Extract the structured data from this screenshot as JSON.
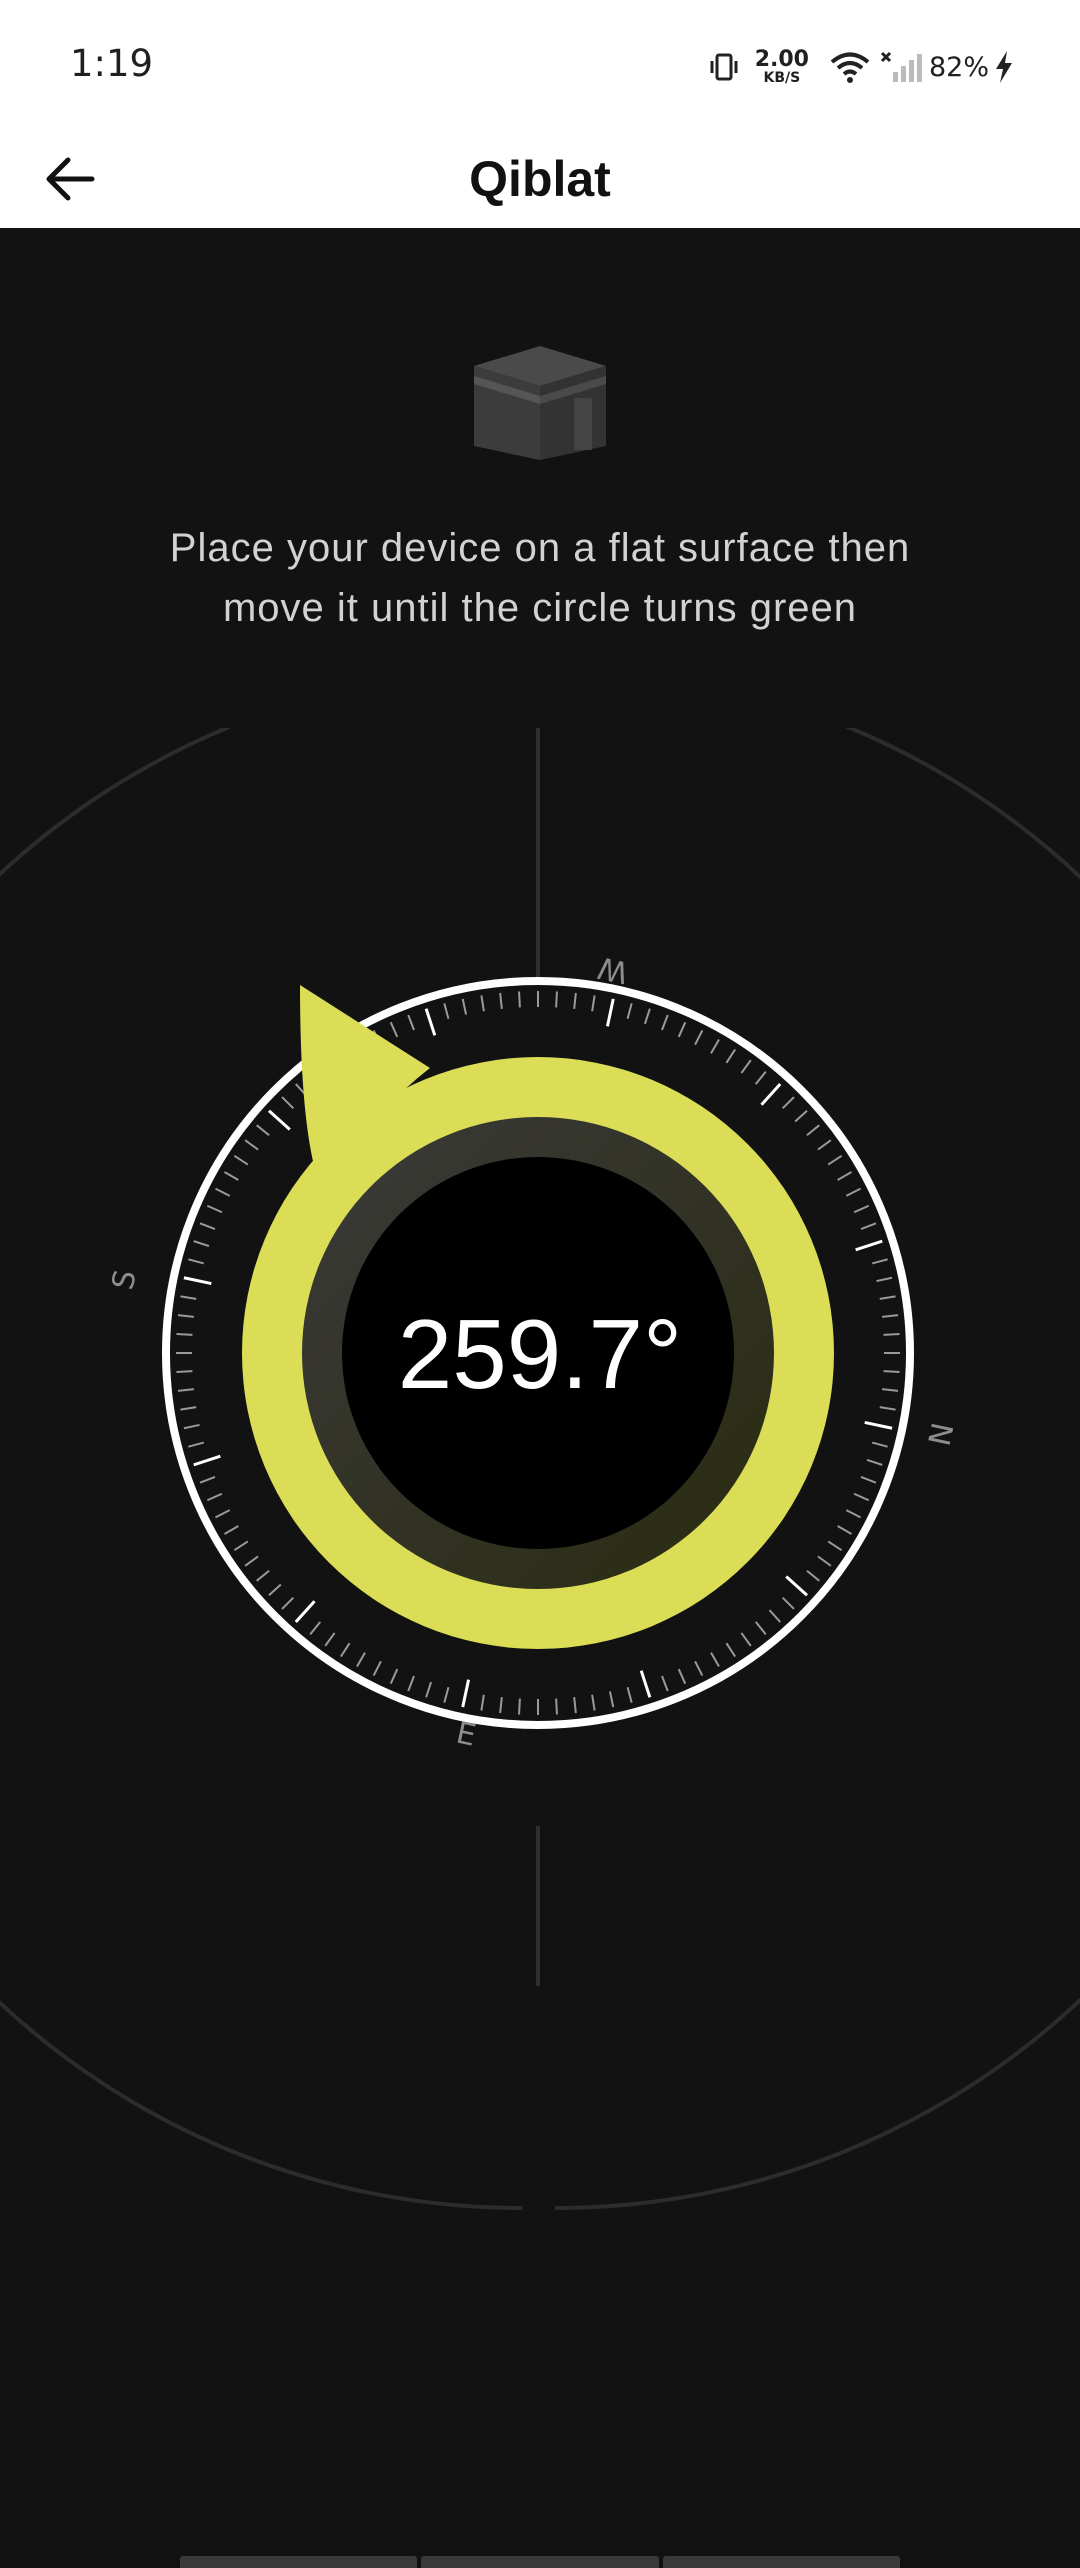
{
  "status_bar": {
    "time": "1:19",
    "network_speed_value": "2.00",
    "network_speed_unit": "KB/S",
    "battery": "82%",
    "icons": [
      "vibrate-icon",
      "wifi-icon",
      "no-signal-icon",
      "charging-icon"
    ]
  },
  "app_bar": {
    "title": "Qiblat",
    "back_icon": "arrow-left-icon"
  },
  "instruction": "Place your device on a flat surface then\nmove it until the circle turns green",
  "compass": {
    "heading_readout": "259.7°",
    "cardinals": {
      "north": "N",
      "east": "E",
      "south": "S",
      "west": "W"
    },
    "accent_color": "#DADD55",
    "ring_color": "#FFFFFF",
    "background": "#121212"
  },
  "kaaba_icon": "kaaba-icon"
}
